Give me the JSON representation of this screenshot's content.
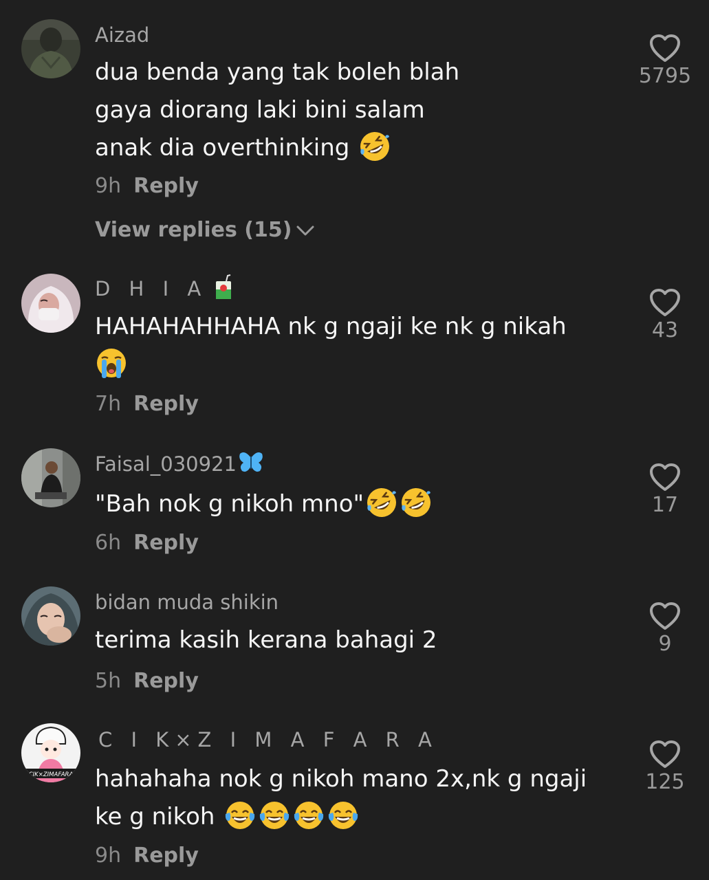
{
  "comments": [
    {
      "username": "Aizad",
      "lines": [
        "dua benda yang tak boleh blah",
        "gaya diorang laki bini salam",
        "anak dia overthinking"
      ],
      "time": "9h",
      "reply_label": "Reply",
      "likes": "5795",
      "view_replies": "View replies (15)",
      "emoji": [
        "rofl-emoji"
      ]
    },
    {
      "username": "D H I A",
      "lines": [
        "HAHAHAHHAHA nk g ngaji ke nk g nikah"
      ],
      "time": "7h",
      "reply_label": "Reply",
      "likes": "43",
      "emoji": [
        "loudly-crying-emoji"
      ],
      "username_icon": "juice-box-icon"
    },
    {
      "username": "Faisal_030921",
      "lines": [
        "\"Bah nok g nikoh mno\""
      ],
      "time": "6h",
      "reply_label": "Reply",
      "likes": "17",
      "emoji": [
        "rofl-emoji",
        "rofl-emoji"
      ],
      "username_icon": "butterfly-icon"
    },
    {
      "username": "bidan muda shikin",
      "lines": [
        "terima kasih kerana bahagi 2"
      ],
      "time": "5h",
      "reply_label": "Reply",
      "likes": "9"
    },
    {
      "username": "C I K×Z I M A F A R A",
      "lines": [
        "hahahaha nok g nikoh mano 2x,nk g ngaji",
        "ke g nikoh"
      ],
      "time": "9h",
      "reply_label": "Reply",
      "likes": "125",
      "emoji": [
        "tears-of-joy-emoji",
        "tears-of-joy-emoji",
        "tears-of-joy-emoji",
        "tears-of-joy-emoji"
      ],
      "avatar_text": "CIK×ZIMAFARA"
    }
  ],
  "colors": {
    "background": "#1f1f1f",
    "text": "#f5f5f5",
    "muted": "#9a9a9a",
    "emoji_yellow": "#f7c22e",
    "butterfly_blue": "#4fb3f5"
  }
}
